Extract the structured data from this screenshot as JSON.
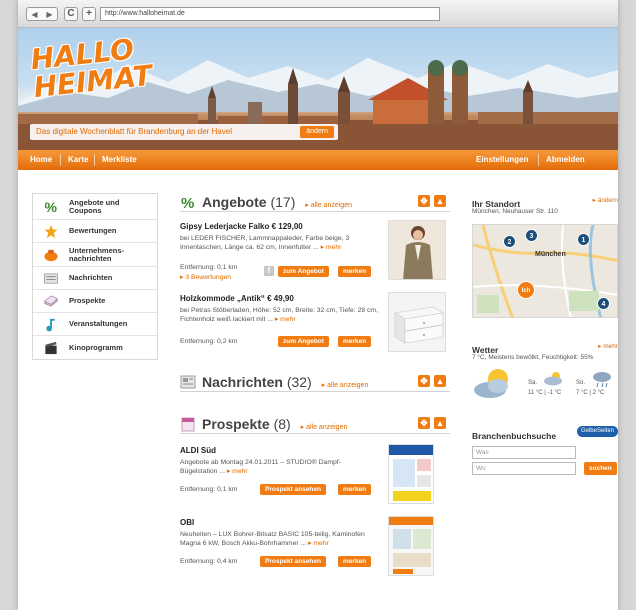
{
  "browser": {
    "url": "http://www.halloheimat.de"
  },
  "header": {
    "logo_line1": "HALLO",
    "logo_line2": "HEIMAT",
    "tagline_prefix": "Das digitale Wochenblatt für",
    "tagline_city": "Brandenburg an der Havel",
    "change_button": "ändern"
  },
  "nav": {
    "left": [
      "Home",
      "Karte",
      "Merkliste"
    ],
    "right": [
      "Einstellungen",
      "Abmelden"
    ]
  },
  "sidebar": {
    "items": [
      {
        "label": "Angebote und Coupons",
        "icon": "percent-icon"
      },
      {
        "label": "Bewertungen",
        "icon": "star-icon"
      },
      {
        "label": "Unternehmens-nachrichten",
        "icon": "company-icon"
      },
      {
        "label": "Nachrichten",
        "icon": "newspaper-icon"
      },
      {
        "label": "Prospekte",
        "icon": "brochure-icon"
      },
      {
        "label": "Veranstaltungen",
        "icon": "music-note-icon"
      },
      {
        "label": "Kinoprogramm",
        "icon": "clapperboard-icon"
      }
    ]
  },
  "angebote": {
    "title": "Angebote",
    "count": "(17)",
    "all_link": "alle anzeigen",
    "items": [
      {
        "title": "Gipsy Lederjacke Falko  € 129,00",
        "desc": "bei LEDER FISCHER, Lammnappaleder, Farbe beige, 3 Innentaschen, Länge ca. 62 cm, Innenfutter ...",
        "more": "mehr",
        "distance": "Entfernung: 0,1 km",
        "reviews": "3 Bewertungen",
        "btn_primary": "zum Angebot",
        "btn_secondary": "merken"
      },
      {
        "title": "Holzkommode „Antik“  € 49,90",
        "desc": "bei Petras Stöberladen, Höhe: 52 cm, Breite: 32 cm, Tiefe: 28 cm, Fichtenholz weiß lackiert mit ...",
        "more": "mehr",
        "distance": "Entfernung: 0,2 km",
        "btn_primary": "zum Angebot",
        "btn_secondary": "merken"
      }
    ]
  },
  "nachrichten": {
    "title": "Nachrichten",
    "count": "(32)",
    "all_link": "alle anzeigen"
  },
  "prospekte": {
    "title": "Prospekte",
    "count": "(8)",
    "all_link": "alle anzeigen",
    "items": [
      {
        "title": "ALDI Süd",
        "desc": "Angebote ab Montag 24.01.2011 – STUDIO® Dampf-Bügelstation ...",
        "more": "mehr",
        "distance": "Entfernung: 0,1 km",
        "btn_primary": "Prospekt ansehen",
        "btn_secondary": "merken"
      },
      {
        "title": "OBI",
        "desc": "Neuheiten – LUX Bohrer-Bitsatz BASIC 105-teilig, Kaminofen Magna 6 kW, Bosch Akku-Bohrhammer ...",
        "more": "mehr",
        "distance": "Entfernung: 0,4 km",
        "btn_primary": "Prospekt ansehen",
        "btn_secondary": "merken"
      }
    ]
  },
  "standort": {
    "title": "Ihr Standort",
    "change_link": "ändern",
    "address": "München, Neuhauser Str. 110",
    "map_city": "München",
    "map_you": "Ich",
    "pins": [
      "1",
      "2",
      "3",
      "4"
    ]
  },
  "wetter": {
    "title": "Wetter",
    "more_link": "mehr",
    "current": "7 °C, Meistens bewölkt, Feuchtigkeit: 55%",
    "day1_label": "Sa.",
    "day1_temp": "11 °C | -1 °C",
    "day2_label": "So.",
    "day2_temp": "7 °C | 2 °C"
  },
  "branchenbuch": {
    "title": "Branchenbuchsuche",
    "badge": "GelbeSeiten",
    "was_placeholder": "Was",
    "wo_placeholder": "Wo",
    "search_button": "suchen"
  },
  "colors": {
    "accent": "#f07c12",
    "nav": "#e46c08",
    "link": "#e06a00"
  }
}
